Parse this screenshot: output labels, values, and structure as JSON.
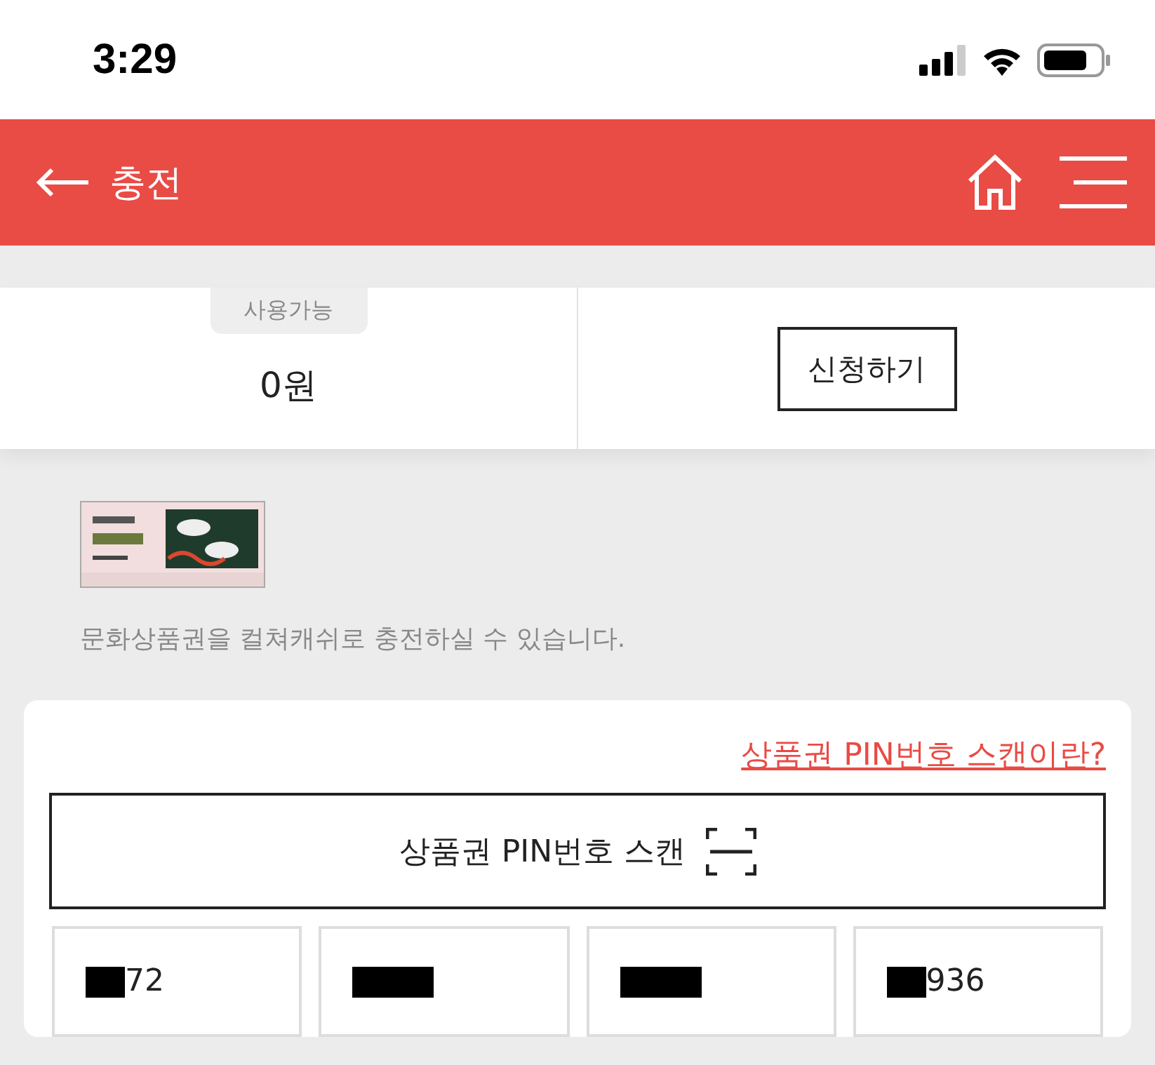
{
  "status_bar": {
    "time": "3:29"
  },
  "header": {
    "title": "충전"
  },
  "balance": {
    "badge": "사용가능",
    "amount": "0원",
    "apply_button": "신청하기"
  },
  "voucher": {
    "description": "문화상품권을 컬쳐캐쉬로 충전하실 수 있습니다."
  },
  "pin_card": {
    "help_link": "상품권 PIN번호 스캔이란?",
    "scan_button": "상품권 PIN번호 스캔",
    "pin_fields": [
      {
        "value": "72",
        "redacted": true
      },
      {
        "redacted": true
      },
      {
        "redacted": true
      },
      {
        "value": "936",
        "redacted": true
      }
    ]
  }
}
